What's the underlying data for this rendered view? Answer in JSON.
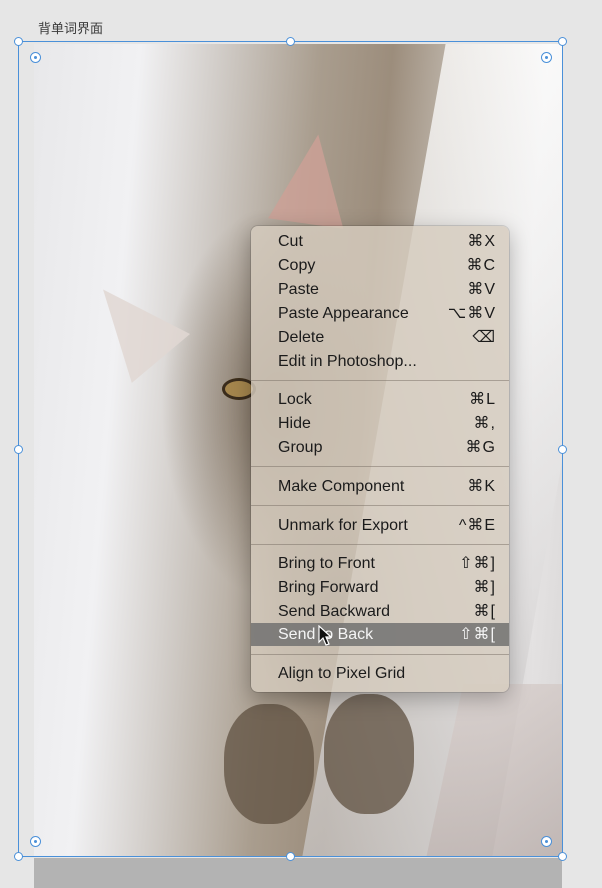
{
  "artboard": {
    "label": "背单词界面"
  },
  "context_menu": {
    "items": [
      {
        "label": "Cut",
        "shortcut": "⌘X"
      },
      {
        "label": "Copy",
        "shortcut": "⌘C"
      },
      {
        "label": "Paste",
        "shortcut": "⌘V"
      },
      {
        "label": "Paste Appearance",
        "shortcut": "⌥⌘V"
      },
      {
        "label": "Delete",
        "shortcut": "⌫"
      },
      {
        "label": "Edit in Photoshop...",
        "shortcut": ""
      },
      {
        "label": "Lock",
        "shortcut": "⌘L"
      },
      {
        "label": "Hide",
        "shortcut": "⌘,"
      },
      {
        "label": "Group",
        "shortcut": "⌘G"
      },
      {
        "label": "Make Component",
        "shortcut": "⌘K"
      },
      {
        "label": "Unmark for Export",
        "shortcut": "^⌘E"
      },
      {
        "label": "Bring to Front",
        "shortcut": "⇧⌘]"
      },
      {
        "label": "Bring Forward",
        "shortcut": "⌘]"
      },
      {
        "label": "Send Backward",
        "shortcut": "⌘["
      },
      {
        "label": "Send to Back",
        "shortcut": "⇧⌘["
      },
      {
        "label": "Align to Pixel Grid",
        "shortcut": ""
      }
    ],
    "highlighted_item": "Send to Back"
  },
  "colors": {
    "selection": "#4a90d9",
    "menu_highlight": "#6e6e6e"
  }
}
